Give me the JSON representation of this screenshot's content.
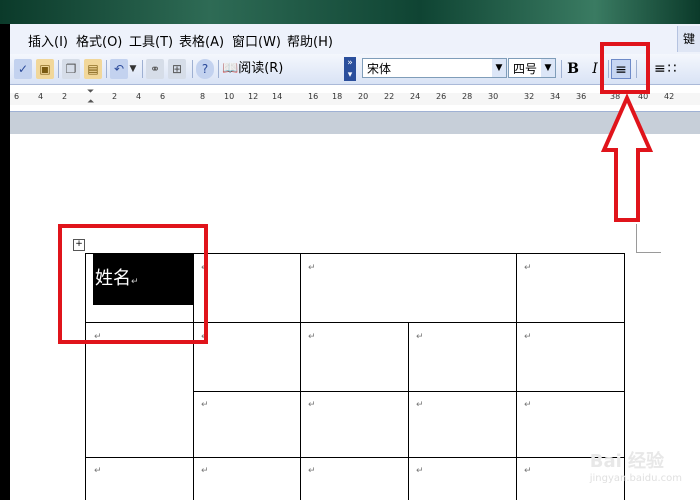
{
  "menu": [
    {
      "key": "frag",
      "label": ")"
    },
    {
      "key": "insert",
      "label": "插入(I)"
    },
    {
      "key": "format",
      "label": "格式(O)"
    },
    {
      "key": "tools",
      "label": "工具(T)"
    },
    {
      "key": "table",
      "label": "表格(A)"
    },
    {
      "key": "window",
      "label": "窗口(W)"
    },
    {
      "key": "help",
      "label": "帮助(H)"
    }
  ],
  "menu_corner": "键",
  "toolbar": {
    "read_label": "阅读(R)",
    "font_name": "宋体",
    "font_size": "四号",
    "bold": "B",
    "italic": "I",
    "icons": [
      "spellcheck-icon",
      "research-icon",
      "copy-icon",
      "paste-icon",
      "undo-icon",
      "hyperlink-icon",
      "table-grid-icon",
      "help-icon",
      "read-mode-icon",
      "align-center-icon",
      "numbering-icon",
      "bullets-icon"
    ]
  },
  "ruler_ticks": [
    "6",
    "4",
    "2",
    "2",
    "4",
    "6",
    "8",
    "10",
    "12",
    "14",
    "16",
    "18",
    "20",
    "22",
    "24",
    "26",
    "28",
    "30",
    "32",
    "34",
    "36",
    "38",
    "40",
    "42"
  ],
  "table": {
    "name_cell": "姓名",
    "cell_mark": "↵"
  },
  "watermark": {
    "brand": "Bai 经验",
    "site": "jingyan.baidu.com"
  },
  "annotation_color": "#e0141b"
}
